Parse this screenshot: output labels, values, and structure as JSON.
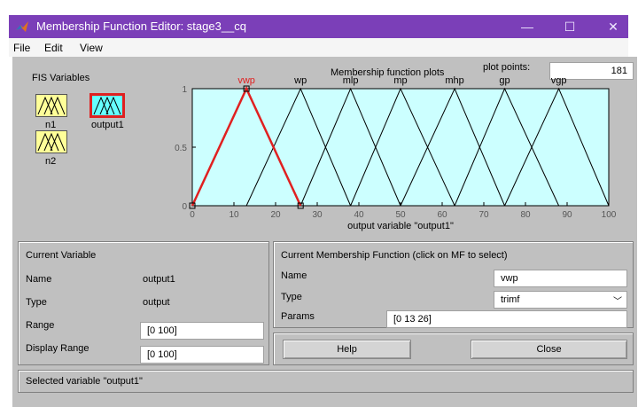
{
  "window": {
    "title": "Membership Function Editor: stage3__cq",
    "controls": [
      "—",
      "☐",
      "✕"
    ]
  },
  "menu": [
    "File",
    "Edit",
    "View"
  ],
  "fis_variables": {
    "label": "FIS Variables",
    "inputs": [
      "n1",
      "n2"
    ],
    "output": "output1"
  },
  "plot_header": {
    "title": "Membership function plots",
    "points_label": "plot points:",
    "points_value": "181"
  },
  "chart_data": {
    "type": "line",
    "xlabel": "output variable \"output1\"",
    "xlim": [
      0,
      100
    ],
    "ylim": [
      0,
      1
    ],
    "xticks": [
      0,
      10,
      20,
      30,
      40,
      50,
      60,
      70,
      80,
      90,
      100
    ],
    "yticks": [
      0,
      0.5,
      1
    ],
    "background": "#ccffff",
    "selected_color": "#e02020",
    "series": [
      {
        "name": "vwp",
        "points": [
          [
            0,
            0
          ],
          [
            13,
            1
          ],
          [
            26,
            0
          ]
        ],
        "selected": true
      },
      {
        "name": "wp",
        "points": [
          [
            13,
            0
          ],
          [
            26,
            1
          ],
          [
            38,
            0
          ]
        ]
      },
      {
        "name": "mlp",
        "points": [
          [
            26,
            0
          ],
          [
            38,
            1
          ],
          [
            50,
            0
          ]
        ]
      },
      {
        "name": "mp",
        "points": [
          [
            38,
            0
          ],
          [
            50,
            1
          ],
          [
            63,
            0
          ]
        ]
      },
      {
        "name": "mhp",
        "points": [
          [
            50,
            0
          ],
          [
            63,
            1
          ],
          [
            75,
            0
          ]
        ]
      },
      {
        "name": "gp",
        "points": [
          [
            63,
            0
          ],
          [
            75,
            1
          ],
          [
            88,
            0
          ]
        ]
      },
      {
        "name": "vgp",
        "points": [
          [
            75,
            0
          ],
          [
            88,
            1
          ],
          [
            100,
            0
          ]
        ]
      }
    ]
  },
  "current_variable": {
    "header": "Current Variable",
    "name_label": "Name",
    "name_value": "output1",
    "type_label": "Type",
    "type_value": "output",
    "range_label": "Range",
    "range_value": "[0 100]",
    "display_range_label": "Display Range",
    "display_range_value": "[0 100]"
  },
  "current_mf": {
    "header": "Current Membership Function (click on MF to select)",
    "name_label": "Name",
    "name_value": "vwp",
    "type_label": "Type",
    "type_value": "trimf",
    "params_label": "Params",
    "params_value": "[0 13 26]"
  },
  "buttons": {
    "help": "Help",
    "close": "Close"
  },
  "status": "Selected variable \"output1\"",
  "colors": {
    "titlebar": "#7b3fb8",
    "input_var": "#ffff99",
    "output_var": "#66ffff",
    "selected_border": "#e02020"
  }
}
